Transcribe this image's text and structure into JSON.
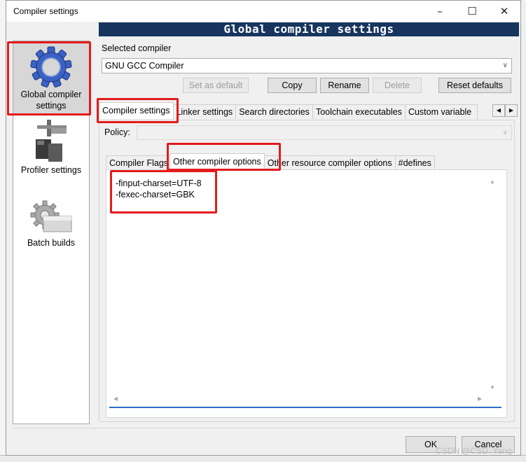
{
  "window": {
    "title": "Compiler settings",
    "banner": "Global compiler settings",
    "controls": {
      "minimize": "–",
      "maximize": "☐",
      "close": "✕"
    }
  },
  "sidebar": {
    "items": [
      {
        "label_line1": "Global compiler",
        "label_line2": "settings",
        "icon": "gear-icon",
        "selected": true
      },
      {
        "label_line1": "Profiler settings",
        "label_line2": "",
        "icon": "profiler-icon",
        "selected": false
      },
      {
        "label_line1": "Batch builds",
        "label_line2": "",
        "icon": "batch-builds-icon",
        "selected": false
      }
    ]
  },
  "compiler": {
    "section_label": "Selected compiler",
    "selected": "GNU GCC Compiler",
    "buttons": {
      "set_default": "Set as default",
      "copy": "Copy",
      "rename": "Rename",
      "delete": "Delete",
      "reset": "Reset defaults"
    }
  },
  "top_tabs": [
    "Compiler settings",
    "Linker settings",
    "Search directories",
    "Toolchain executables",
    "Custom variable"
  ],
  "policy": {
    "label": "Policy:",
    "value": ""
  },
  "sub_tabs": [
    "Compiler Flags",
    "Other compiler options",
    "Other resource compiler options",
    "#defines"
  ],
  "editor": {
    "lines": [
      "-finput-charset=UTF-8",
      "-fexec-charset=GBK"
    ]
  },
  "footer": {
    "ok": "OK",
    "cancel": "Cancel"
  },
  "watermark": "CSDN @CSD_Yang",
  "colors": {
    "banner": "#17355f",
    "highlight": "#e31b1b",
    "accent_line": "#2a6fc4"
  }
}
